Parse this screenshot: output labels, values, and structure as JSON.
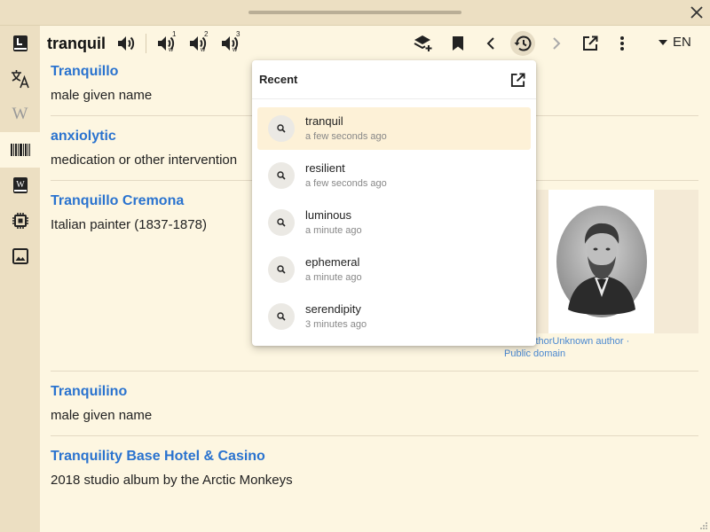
{
  "app": {
    "accent": "#2a73cf",
    "sidebar_bg": "#ecdfc2",
    "content_bg": "#fdf6e1"
  },
  "titlebar": {
    "close_icon": "close-icon"
  },
  "sidebar": {
    "items": [
      {
        "name": "dictionary",
        "icon": "dictionary-icon"
      },
      {
        "name": "translate",
        "icon": "translate-icon"
      },
      {
        "name": "wikipedia",
        "icon": "wikipedia-icon"
      },
      {
        "name": "wikidata",
        "icon": "barcode-icon"
      },
      {
        "name": "wikisource",
        "icon": "wiki-book-icon"
      },
      {
        "name": "chip",
        "icon": "chip-icon"
      },
      {
        "name": "images",
        "icon": "image-icon"
      }
    ]
  },
  "toolbar": {
    "word": "tranquil",
    "speakers": [
      {
        "label": "",
        "sub": ""
      },
      {
        "label": "1",
        "sub": "w"
      },
      {
        "label": "2",
        "sub": "w"
      },
      {
        "label": "3",
        "sub": "w"
      }
    ],
    "language": "EN"
  },
  "results": [
    {
      "title": "Tranquillo",
      "desc": "male given name"
    },
    {
      "title": "anxiolytic",
      "desc": "medication or other intervention"
    },
    {
      "title": "Tranquillo Cremona",
      "desc": "Italian painter (1837-1878)"
    },
    {
      "title": "Tranquilino",
      "desc": "male given name"
    },
    {
      "title": "Tranquility Base Hotel & Casino",
      "desc": "2018 studio album by the Arctic Monkeys"
    }
  ],
  "image_caption": {
    "line1": "own authorUnknown author ·",
    "line2": "Public domain"
  },
  "recent": {
    "title": "Recent",
    "items": [
      {
        "term": "tranquil",
        "time": "a few seconds ago"
      },
      {
        "term": "resilient",
        "time": "a few seconds ago"
      },
      {
        "term": "luminous",
        "time": "a minute ago"
      },
      {
        "term": "ephemeral",
        "time": "a minute ago"
      },
      {
        "term": "serendipity",
        "time": "3 minutes ago"
      }
    ]
  }
}
